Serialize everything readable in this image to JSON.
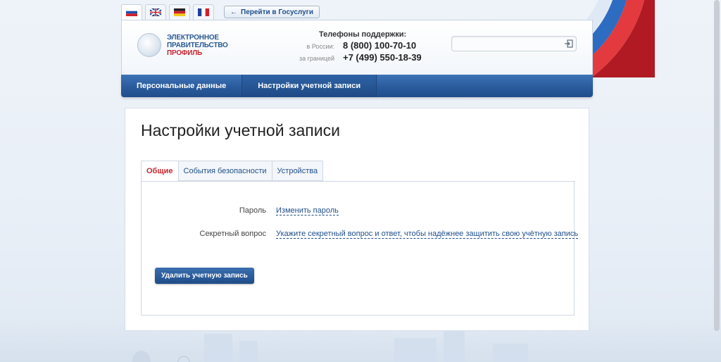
{
  "languages": [
    {
      "code": "ru",
      "name": "russia-flag-icon",
      "active": true
    },
    {
      "code": "en",
      "name": "uk-flag-icon",
      "active": false
    },
    {
      "code": "de",
      "name": "germany-flag-icon",
      "active": false
    },
    {
      "code": "fr",
      "name": "france-flag-icon",
      "active": false
    }
  ],
  "goto_portal": {
    "arrow": "←",
    "label": "Перейти в Госуслуги"
  },
  "logo": {
    "line1": "ЭЛЕКТРОННОЕ",
    "line2": "ПРАВИТЕЛЬСТВО",
    "line3": "ПРОФИЛЬ"
  },
  "support": {
    "title": "Телефоны поддержки:",
    "russia_label": "в России:",
    "russia_phone": "8 (800) 100-70-10",
    "abroad_label": "за границей",
    "abroad_phone": "+7 (499) 550-18-39"
  },
  "search": {
    "placeholder": ""
  },
  "nav": {
    "personal": "Персональные данные",
    "settings": "Настройки учетной записи"
  },
  "page": {
    "title": "Настройки учетной записи"
  },
  "tabs": {
    "general": "Общие",
    "security": "События безопасности",
    "devices": "Устройства"
  },
  "settings": {
    "password_label": "Пароль",
    "password_link": "Изменить пароль",
    "secret_label": "Секретный вопрос",
    "secret_link": "Укажите секретный вопрос и ответ, чтобы надёжнее защитить свою учётную запись"
  },
  "delete_button": "Удалить учетную запись",
  "colors": {
    "accent_blue": "#2a5b9c",
    "link": "#1f4f8a",
    "active_tab": "#c6262e"
  }
}
